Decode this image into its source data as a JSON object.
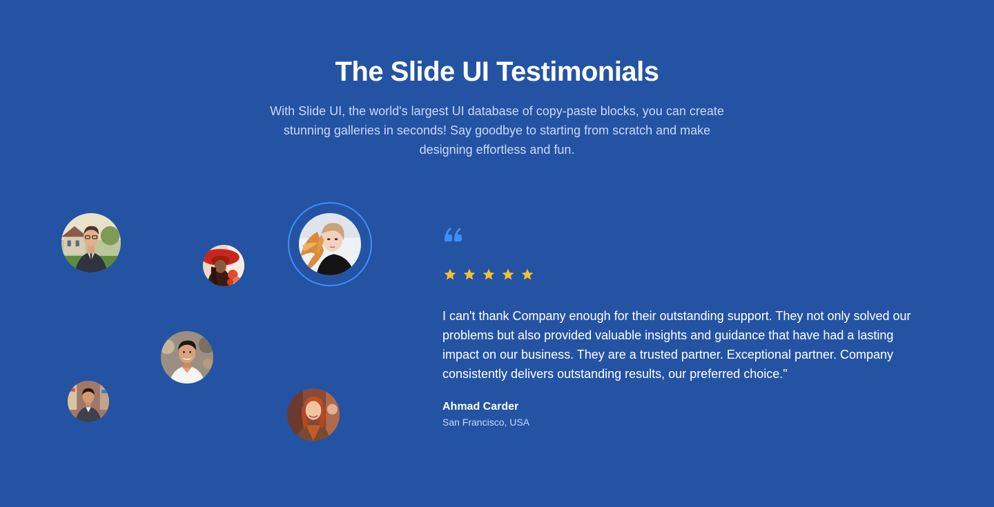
{
  "section": {
    "title": "The Slide UI Testimonials",
    "subtitle": "With Slide UI, the world's largest UI database of copy-paste blocks, you can create stunning galleries in seconds! Say goodbye to starting from scratch and make designing effortless and fun."
  },
  "colors": {
    "background": "#2453a4",
    "accent": "#3f8ef7",
    "star": "#f6c12b",
    "muted_text": "#c9d9f5"
  },
  "avatars": [
    {
      "name": "avatar-man-suit-building",
      "active": false
    },
    {
      "name": "avatar-woman-red-hat",
      "active": false
    },
    {
      "name": "avatar-woman-flowing-hair",
      "active": true
    },
    {
      "name": "avatar-smiling-man",
      "active": false
    },
    {
      "name": "avatar-man-suit-shop",
      "active": false
    },
    {
      "name": "avatar-woman-red-hair",
      "active": false
    }
  ],
  "testimonial": {
    "quote_icon": "quote-icon",
    "rating": 5,
    "rating_max": 5,
    "text": "I can't thank Company enough for their outstanding support. They not only solved our problems but also provided valuable insights and guidance that have had a lasting impact on our business. They are a trusted partner. Exceptional partner. Company consistently delivers outstanding results, our preferred choice.\"",
    "author_name": "Ahmad Carder",
    "author_location": "San Francisco, USA"
  }
}
